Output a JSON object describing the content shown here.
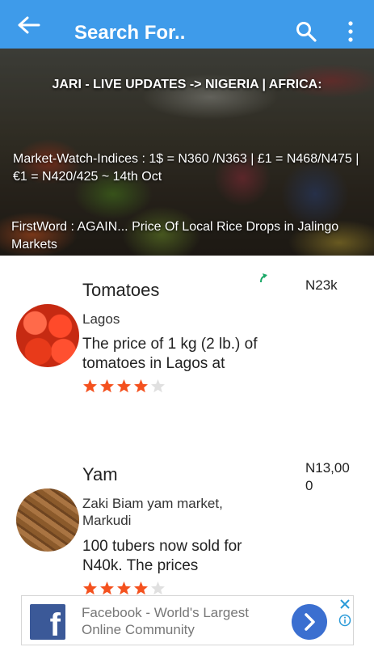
{
  "appbar": {
    "title": "Search For..",
    "back_icon": "arrow-left-icon",
    "search_icon": "search-icon",
    "more_icon": "more-vert-icon",
    "color": "#3e9bea"
  },
  "banner": {
    "headline": "JARI - LIVE UPDATES -> NIGERIA | AFRICA:",
    "indices": "Market-Watch-Indices : 1$ = N360 /N363   |   £1 = N468/N475    |     €1 = N420/425    ~ 14th Oct",
    "firstword": "FirstWord : AGAIN... Price Of Local Rice Drops in Jalingo Markets"
  },
  "items": [
    {
      "name": "Tomatoes",
      "location": "Lagos",
      "description": "The price of 1 kg (2 lb.) of tomatoes in Lagos at",
      "price": "N23k",
      "rating": 4,
      "max_rating": 5,
      "trend_icon": "trend-up-icon"
    },
    {
      "name": "Yam",
      "location": "Zaki Biam yam market, Markudi",
      "description": "100 tubers now sold for N40k. The prices",
      "price": "N13,000",
      "rating": 4,
      "max_rating": 5
    }
  ],
  "ad": {
    "text": "Facebook - World's Largest Online Community",
    "logo_icon": "facebook-logo-icon",
    "go_icon": "chevron-right-icon",
    "close_icon": "close-icon",
    "info_icon": "info-icon",
    "brand_color": "#3b5998"
  },
  "colors": {
    "star_filled": "#f4511e",
    "star_empty": "#e0e0e0",
    "trend": "#1aa867"
  }
}
